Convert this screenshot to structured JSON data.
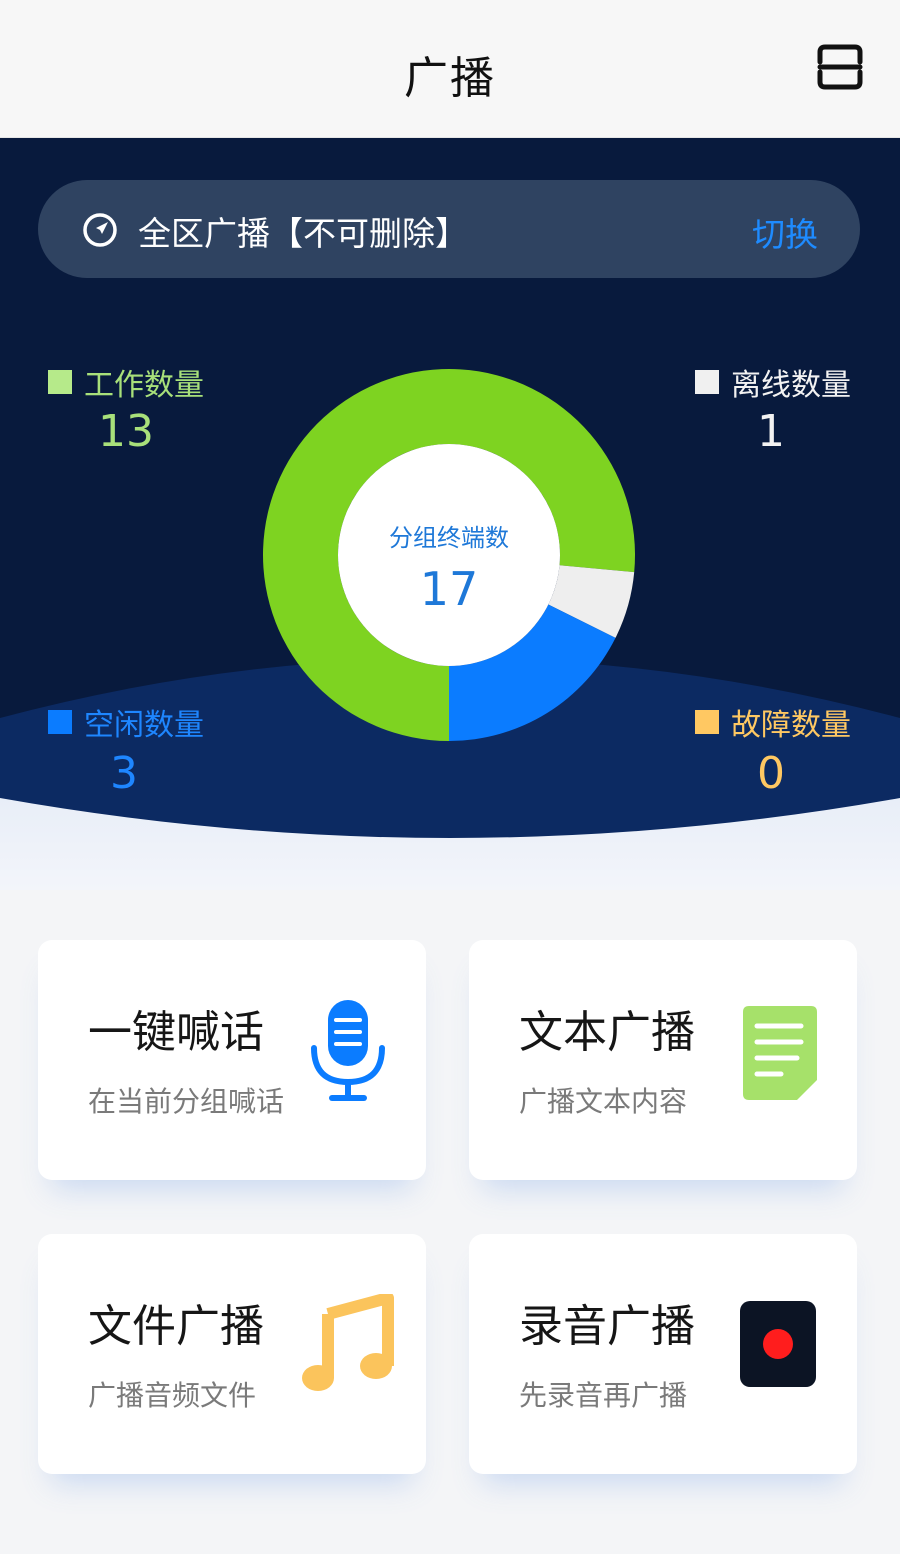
{
  "header": {
    "title": "广播",
    "menu_icon": "scan-menu-icon"
  },
  "switch_bar": {
    "icon": "navigation-icon",
    "zone_name": "全区广播【不可删除】",
    "switch_label": "切换",
    "switch_color": "#1e8bff"
  },
  "stats": {
    "working": {
      "label": "工作数量",
      "value": "13",
      "color": "#7ed321"
    },
    "offline": {
      "label": "离线数量",
      "value": "1",
      "color": "#f0f0f0"
    },
    "idle": {
      "label": "空闲数量",
      "value": "3",
      "color": "#0b7cff"
    },
    "fault": {
      "label": "故障数量",
      "value": "0",
      "color": "#ffc862"
    }
  },
  "chart_data": {
    "type": "pie",
    "center_label": "分组终端数",
    "center_value": "17",
    "slices": [
      {
        "name": "工作数量",
        "value": 13,
        "color": "#7ed321"
      },
      {
        "name": "离线数量",
        "value": 1,
        "color": "#eeeeee"
      },
      {
        "name": "空闲数量",
        "value": 3,
        "color": "#0b7cff"
      },
      {
        "name": "故障数量",
        "value": 0,
        "color": "#ffc862"
      }
    ]
  },
  "cards": [
    {
      "title": "一键喊话",
      "subtitle": "在当前分组喊话",
      "icon": "microphone-icon"
    },
    {
      "title": "文本广播",
      "subtitle": "广播文本内容",
      "icon": "document-icon"
    },
    {
      "title": "文件广播",
      "subtitle": "广播音频文件",
      "icon": "music-note-icon"
    },
    {
      "title": "录音广播",
      "subtitle": "先录音再广播",
      "icon": "record-icon"
    }
  ]
}
